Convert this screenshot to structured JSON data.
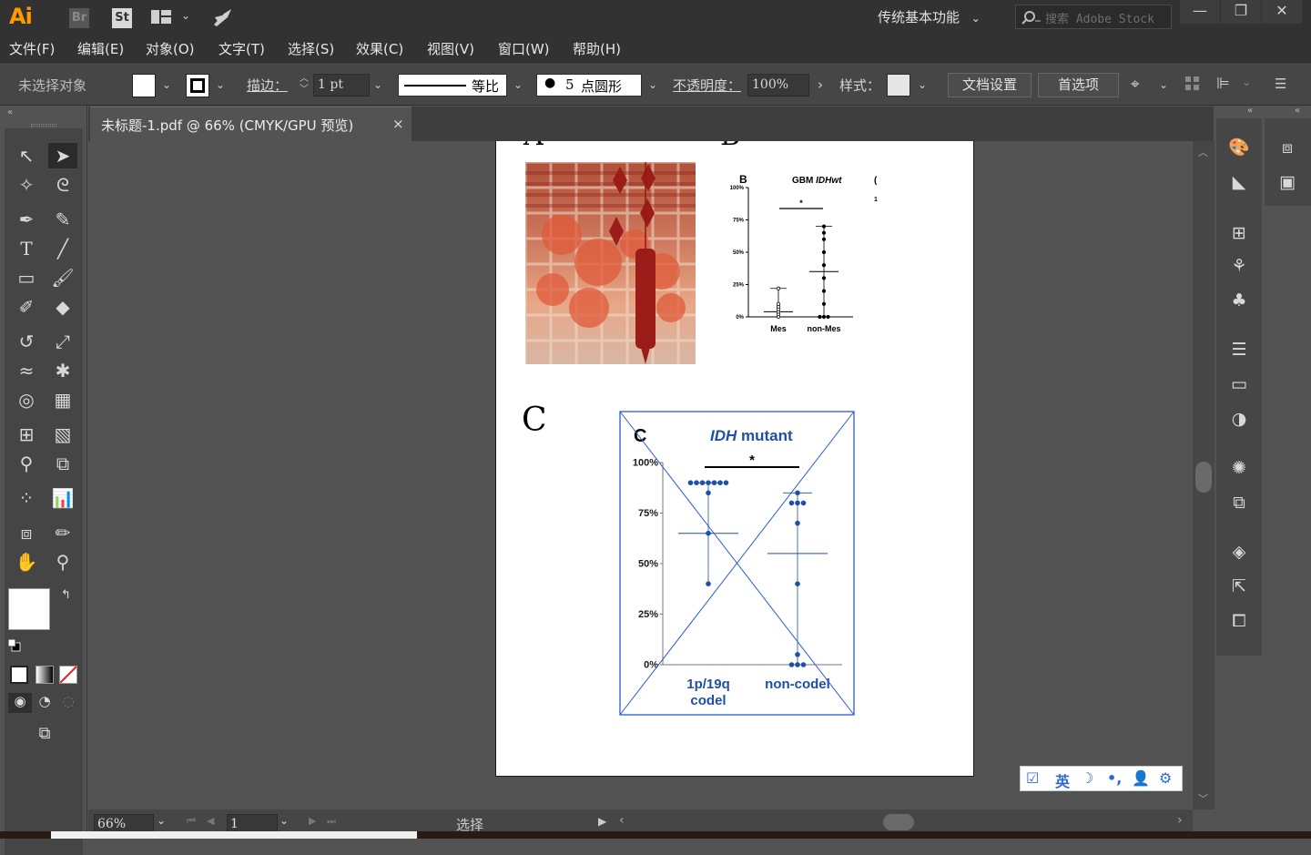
{
  "app": {
    "logo": "Ai",
    "bridge_badge": "Br",
    "stock_badge": "St",
    "workspace": "传统基本功能",
    "stock_search_placeholder": "搜索 Adobe Stock"
  },
  "menu": [
    "文件(F)",
    "编辑(E)",
    "对象(O)",
    "文字(T)",
    "选择(S)",
    "效果(C)",
    "视图(V)",
    "窗口(W)",
    "帮助(H)"
  ],
  "control": {
    "selection": "未选择对象",
    "stroke_label": "描边：",
    "stroke_weight": "1 pt",
    "stroke_profile": "等比",
    "brush_size": "5",
    "brush_name": "点圆形",
    "opacity_label": "不透明度：",
    "opacity_value": "100%",
    "style_label": "样式：",
    "doc_setup": "文档设置",
    "prefs": "首选项"
  },
  "document": {
    "tab_title": "未标题-1.pdf @ 66% (CMYK/GPU 预览)",
    "close": "×"
  },
  "figure": {
    "panel_a_label": "A",
    "panel_b_label": "B",
    "panel_c_label": "C",
    "chart_b": {
      "letter": "B",
      "title": "GBM IDHwt",
      "star": "*"
    },
    "chart_c": {
      "letter": "C",
      "title": "IDH mutant",
      "star": "*"
    }
  },
  "chart_data": [
    {
      "type": "scatter",
      "title": "GBM IDHwt",
      "categories": [
        "Mes",
        "non-Mes"
      ],
      "y_ticks": [
        "100%",
        "75%",
        "50%",
        "25%",
        "0%"
      ],
      "ylim": [
        0,
        100
      ],
      "series": [
        {
          "values": [
            [
              0,
              2,
              4,
              6,
              8,
              10,
              22
            ],
            [
              0,
              0,
              0,
              10,
              20,
              30,
              40,
              50,
              60,
              65,
              70
            ]
          ]
        }
      ],
      "means": [
        4,
        35
      ],
      "annotation": "*"
    },
    {
      "type": "scatter",
      "title": "IDH mutant",
      "categories": [
        "1p/19q codel",
        "non-codel"
      ],
      "y_ticks": [
        "100%",
        "75%",
        "50%",
        "25%",
        "0%"
      ],
      "ylim": [
        0,
        100
      ],
      "series": [
        {
          "values": [
            [
              40,
              65,
              85,
              90,
              90,
              90,
              90,
              90,
              90,
              90
            ],
            [
              0,
              0,
              0,
              5,
              40,
              70,
              80,
              80,
              80,
              85
            ]
          ]
        }
      ],
      "means": [
        65,
        55
      ],
      "annotation": "*"
    }
  ],
  "status": {
    "zoom": "66%",
    "artboard_num": "1",
    "tool": "选择"
  },
  "ime": {
    "lang": "英"
  }
}
